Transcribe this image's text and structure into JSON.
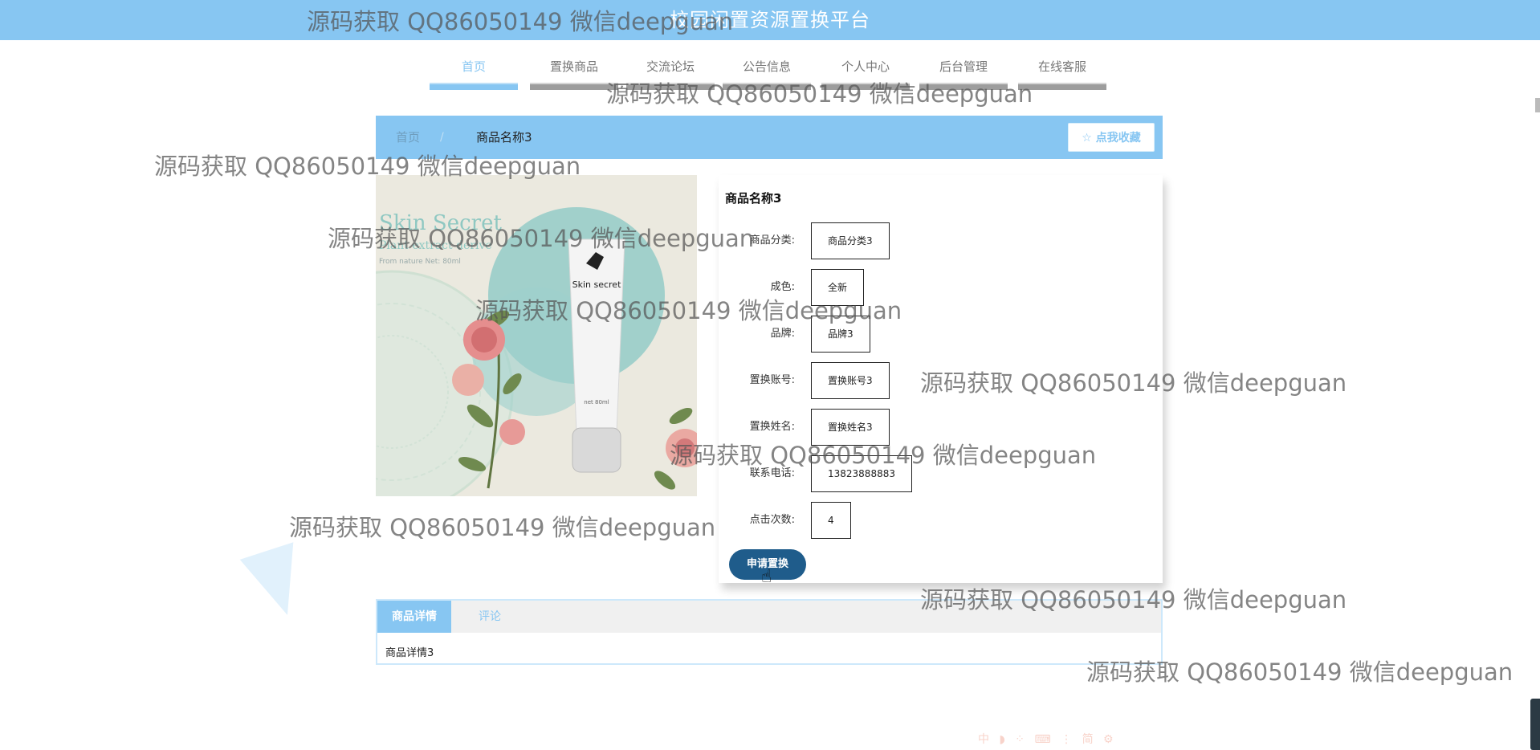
{
  "header": {
    "title": "校园闲置资源置换平台"
  },
  "nav": {
    "items": [
      {
        "label": "首页",
        "active": true
      },
      {
        "label": "置换商品"
      },
      {
        "label": "交流论坛"
      },
      {
        "label": "公告信息"
      },
      {
        "label": "个人中心"
      },
      {
        "label": "后台管理"
      },
      {
        "label": "在线客服"
      }
    ]
  },
  "breadcrumb": {
    "home": "首页",
    "separator": "/",
    "current": "商品名称3"
  },
  "favorite_button": {
    "label": "☆ 点我收藏"
  },
  "product": {
    "name": "商品名称3",
    "image_alt_text": {
      "brand": "Skin secret",
      "bg_title": "Skin Secret",
      "bg_sub": "Plant extract derive",
      "bg_note": "From nature Net: 80ml",
      "tube_note": "net 80ml"
    },
    "fields": [
      {
        "label": "商品分类:",
        "value": "商品分类3"
      },
      {
        "label": "成色:",
        "value": "全新"
      },
      {
        "label": "品牌:",
        "value": "品牌3"
      },
      {
        "label": "置换账号:",
        "value": "置换账号3"
      },
      {
        "label": "置换姓名:",
        "value": "置换姓名3"
      },
      {
        "label": "联系电话:",
        "value": "13823888883"
      },
      {
        "label": "点击次数:",
        "value": "4"
      }
    ],
    "apply_button": "申请置换"
  },
  "tabs": {
    "items": [
      {
        "label": "商品详情",
        "active": true
      },
      {
        "label": "评论"
      }
    ],
    "content": "商品详情3"
  },
  "watermark": {
    "text": "源码获取 QQ86050149 微信deepguan"
  },
  "ime_toolbar": {
    "text": "中 ◗ ⁘ ⌨ ⋮ 简 ⚙"
  },
  "colors": {
    "accent": "#87c6f2",
    "primary_button": "#1f5c8b"
  }
}
